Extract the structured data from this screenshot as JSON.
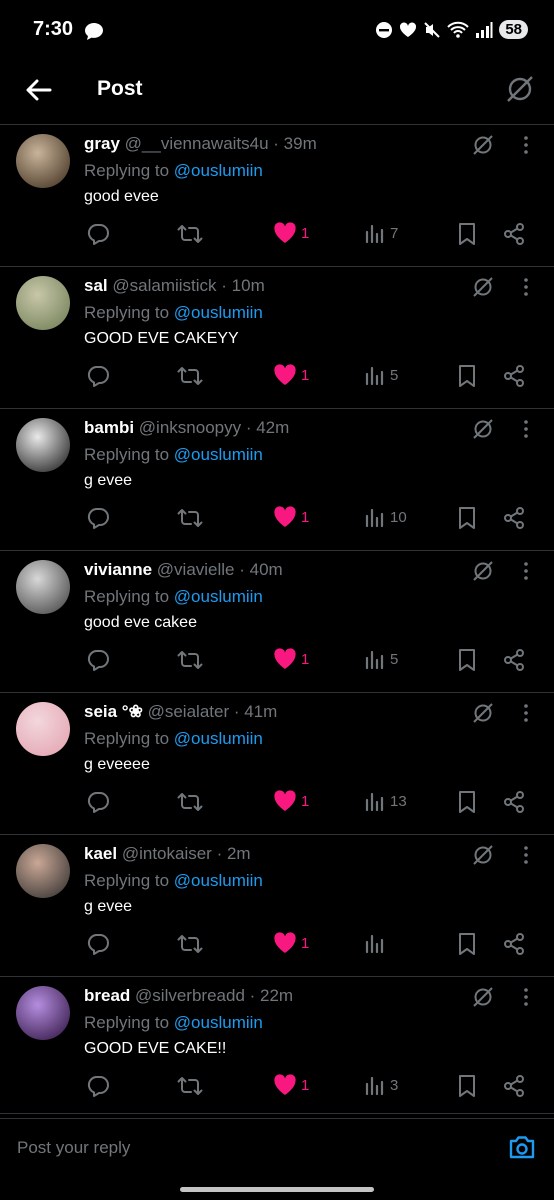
{
  "status_bar": {
    "time": "7:30",
    "battery": "58"
  },
  "header": {
    "title": "Post"
  },
  "posts": [
    {
      "name": "gray",
      "handle": "@__viennawaits4u",
      "time": "· 39m",
      "reply_prefix": "Replying to",
      "mention": "@ouslumiin",
      "text": "good evee",
      "likes": "1",
      "views": "7"
    },
    {
      "name": "sal",
      "handle": "@salamiistick",
      "time": "· 10m",
      "reply_prefix": "Replying to",
      "mention": "@ouslumiin",
      "text": "GOOD EVE CAKEYY",
      "likes": "1",
      "views": "5"
    },
    {
      "name": "bambi",
      "handle": "@inksnoopyy",
      "time": "· 42m",
      "reply_prefix": "Replying to",
      "mention": "@ouslumiin",
      "text": "g evee",
      "likes": "1",
      "views": "10"
    },
    {
      "name": "vivianne",
      "handle": "@viavielle",
      "time": "· 40m",
      "reply_prefix": "Replying to",
      "mention": "@ouslumiin",
      "text": "good eve cakee",
      "likes": "1",
      "views": "5"
    },
    {
      "name": "seia °❀",
      "handle": "@seialater",
      "time": "· 41m",
      "reply_prefix": "Replying to",
      "mention": "@ouslumiin",
      "text": "g eveeee",
      "likes": "1",
      "views": "13"
    },
    {
      "name": "kael",
      "handle": "@intokaiser",
      "time": "· 2m",
      "reply_prefix": "Replying to",
      "mention": "@ouslumiin",
      "text": "g evee",
      "likes": "1",
      "views": ""
    },
    {
      "name": "bread",
      "handle": "@silverbreadd",
      "time": "· 22m",
      "reply_prefix": "Replying to",
      "mention": "@ouslumiin",
      "text": "GOOD EVE CAKE!!",
      "likes": "1",
      "views": "3"
    }
  ],
  "composer": {
    "placeholder": "Post your reply"
  },
  "colors": {
    "accent": "#1d9bf0",
    "like": "#f91880",
    "muted": "#71767b",
    "divider": "#2f3336",
    "background": "#000000"
  },
  "icons": [
    "back-arrow-icon",
    "grok-icon",
    "more-icon",
    "reply-icon",
    "repost-icon",
    "heart-icon",
    "views-icon",
    "bookmark-icon",
    "share-icon",
    "camera-icon"
  ]
}
